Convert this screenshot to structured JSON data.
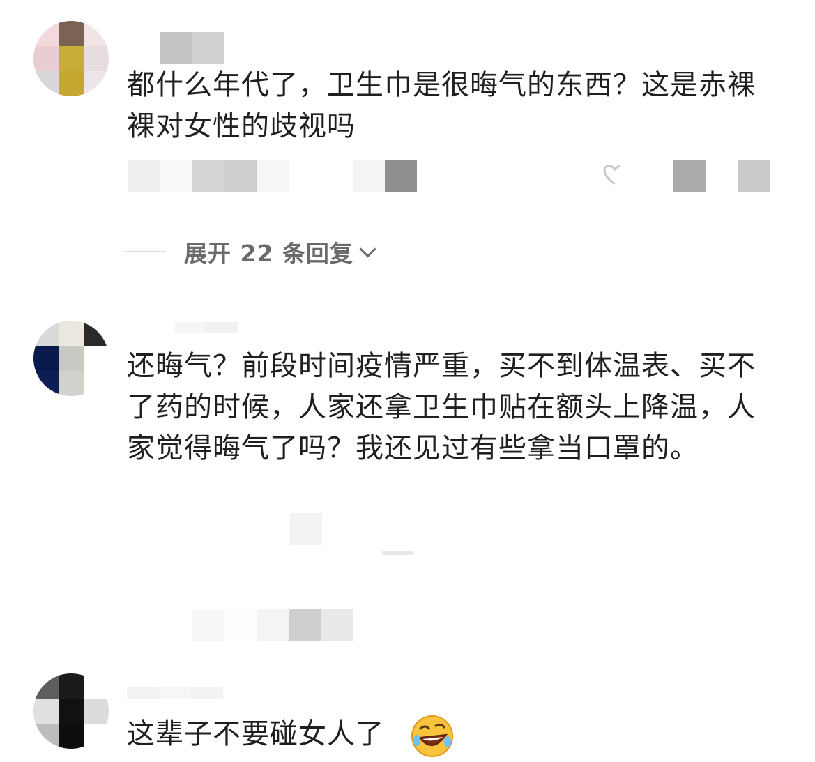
{
  "comments": [
    {
      "text": "都什么年代了，卫生巾是很晦气的东西？这是赤裸裸对女性的歧视吗",
      "expand_label": "展开 22 条回复"
    },
    {
      "text": "还晦气？前段时间疫情严重，买不到体温表、买不了药的时候，人家还拿卫生巾贴在额头上降温，人家觉得晦气了吗？我还见过有些拿当口罩的。"
    },
    {
      "text": "这辈子不要碰女人了",
      "emoji": "rofl-emoji"
    }
  ],
  "colors": {
    "text": "#1f1f1f",
    "secondary_text": "#6a6a6a",
    "background": "#ffffff"
  }
}
